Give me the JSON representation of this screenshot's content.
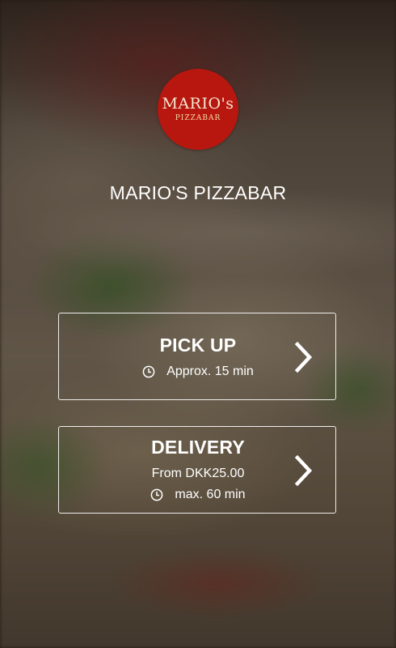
{
  "restaurant": {
    "logo_line1": "MARIO's",
    "logo_line2": "PIZZABAR",
    "name": "MARIO'S PIZZABAR",
    "brand_color": "#b8170f"
  },
  "options": {
    "pickup": {
      "title": "PICK UP",
      "time": "Approx. 15 min",
      "icon": "clock-icon",
      "action_icon": "chevron-right-icon"
    },
    "delivery": {
      "title": "DELIVERY",
      "price": "From DKK25.00",
      "time": "max. 60 min",
      "icon": "clock-icon",
      "action_icon": "chevron-right-icon"
    }
  }
}
